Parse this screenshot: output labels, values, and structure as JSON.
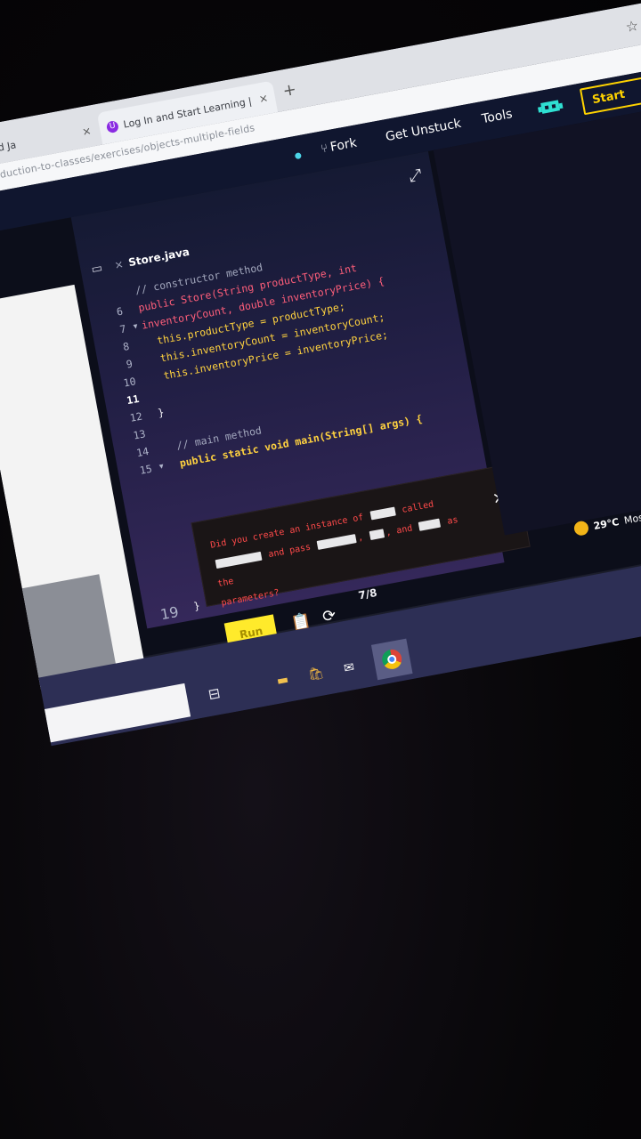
{
  "browser": {
    "tabs": [
      {
        "title": "ct-Oriented Ja"
      },
      {
        "title": "Log In and Start Learning | Ude"
      }
    ],
    "new_tab": "+",
    "close_glyph": "×",
    "star_icon": "☆",
    "address": "java-introduction-to-classes/exercises/objects-multiple-fields"
  },
  "header": {
    "fork_label": "Fork",
    "get_unstuck_label": "Get Unstuck",
    "tools_label": "Tools",
    "start_label": "Start"
  },
  "editor": {
    "filename": "Store.java",
    "lines": [
      {
        "num": "",
        "code": "// constructor method"
      },
      {
        "num": "6",
        "code": "public Store(String productType, int"
      },
      {
        "num": "7",
        "code": "inventoryCount, double inventoryPrice) {"
      },
      {
        "num": "8",
        "code": "  this.productType = productType;"
      },
      {
        "num": "9",
        "code": "  this.inventoryCount = inventoryCount;"
      },
      {
        "num": "10",
        "code": "  this.inventoryPrice = inventoryPrice;"
      },
      {
        "num": "11",
        "code": ""
      },
      {
        "num": "12",
        "code": "}"
      },
      {
        "num": "13",
        "code": ""
      },
      {
        "num": "14",
        "code": "  // main method"
      },
      {
        "num": "15",
        "code": "  public static void main(String[] args) {"
      }
    ],
    "hidden_line_num": "19",
    "hidden_line_code": "}"
  },
  "hint": {
    "part1": "Did you create an instance of",
    "part2": "called",
    "part3": "and pass",
    "part4": ",",
    "part5": ", and",
    "part6": "as the",
    "part7": "parameters?"
  },
  "actions": {
    "run_label": "Run",
    "progress": "7/8"
  },
  "taskbar": {
    "temperature": "29°C",
    "condition": "Mostly clear"
  }
}
